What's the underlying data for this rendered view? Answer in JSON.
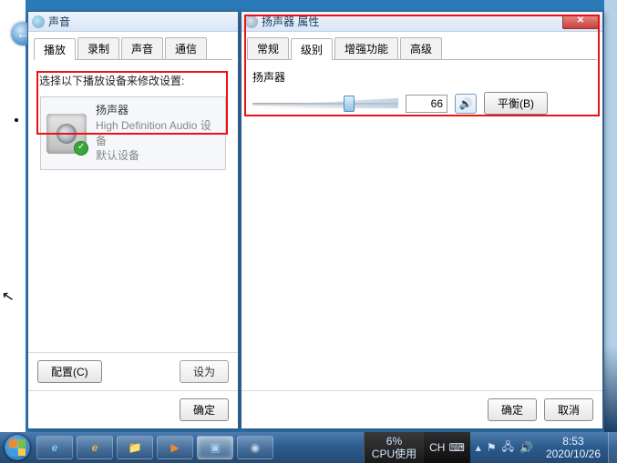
{
  "sound_dialog": {
    "title": "声音",
    "tabs": [
      "播放",
      "录制",
      "声音",
      "通信"
    ],
    "active_tab_index": 0,
    "instruction": "选择以下播放设备来修改设置:",
    "device": {
      "name": "扬声器",
      "subtitle": "High Definition Audio 设备",
      "status": "默认设备"
    },
    "configure_btn": "配置(C)",
    "set_default_btn": "设为",
    "ok_btn": "确定"
  },
  "props_dialog": {
    "title": "扬声器 属性",
    "tabs": [
      "常规",
      "级别",
      "增强功能",
      "高级"
    ],
    "active_tab_index": 1,
    "section_label": "扬声器",
    "volume_value": "66",
    "balance_btn": "平衡(B)",
    "ok_btn": "确定",
    "cancel_btn": "取消"
  },
  "taskbar": {
    "gadget_line1": "6%",
    "gadget_line2": "CPU使用",
    "lang": "CH",
    "clock_time": "8:53",
    "clock_date": "2020/10/26"
  }
}
